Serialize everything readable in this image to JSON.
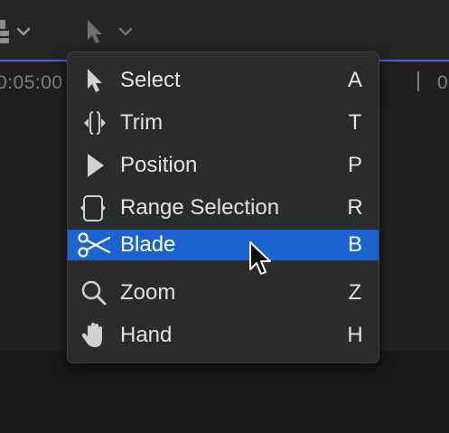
{
  "timeline": {
    "timecode_left": "0:05:00",
    "timecode_right": "0"
  },
  "toolbar": {
    "layout_icon": "clip-layout-icon",
    "tool_icon": "arrow-pointer-icon",
    "dropdown_icon": "chevron-down-icon"
  },
  "tools_menu": {
    "items": [
      {
        "label": "Select",
        "shortcut": "A",
        "icon": "arrow-pointer-icon",
        "selected": false
      },
      {
        "label": "Trim",
        "shortcut": "T",
        "icon": "trim-icon",
        "selected": false
      },
      {
        "label": "Position",
        "shortcut": "P",
        "icon": "position-icon",
        "selected": false
      },
      {
        "label": "Range Selection",
        "shortcut": "R",
        "icon": "range-selection-icon",
        "selected": false
      },
      {
        "label": "Blade",
        "shortcut": "B",
        "icon": "scissors-icon",
        "selected": true
      },
      {
        "label": "Zoom",
        "shortcut": "Z",
        "icon": "magnifier-icon",
        "selected": false
      },
      {
        "label": "Hand",
        "shortcut": "H",
        "icon": "hand-icon",
        "selected": false
      }
    ]
  },
  "colors": {
    "selection": "#1c63d0",
    "menu_background": "#2b2b2b",
    "toolbar_background": "#262626",
    "accent_line": "#4a67d8"
  }
}
